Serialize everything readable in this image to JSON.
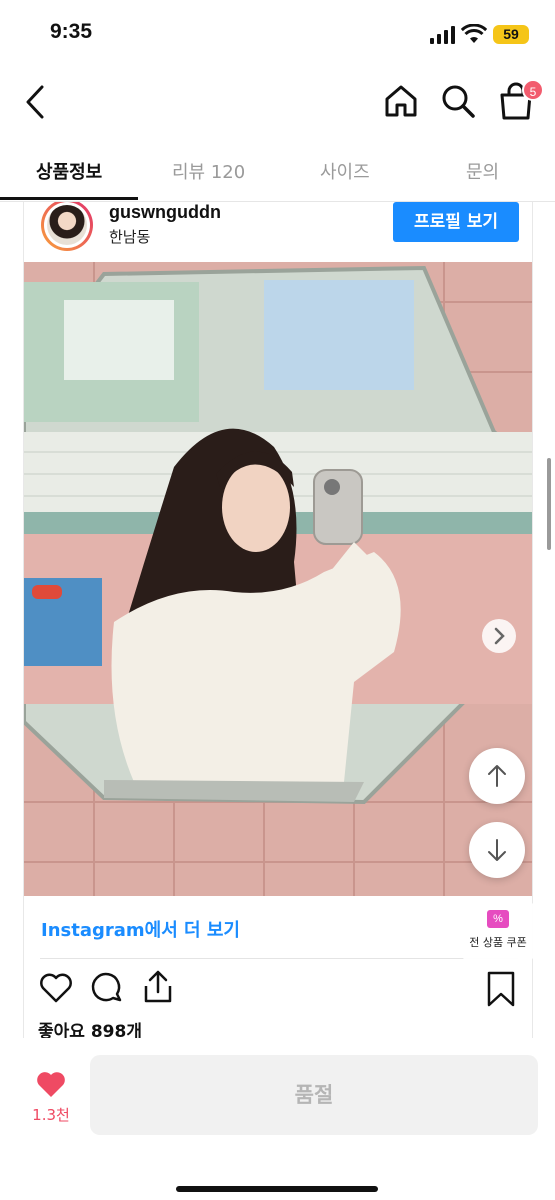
{
  "status_bar": {
    "time": "9:35",
    "battery": "59"
  },
  "nav": {
    "cart_count": "5"
  },
  "tabs": [
    {
      "label": "상품정보"
    },
    {
      "label": "리뷰 120"
    },
    {
      "label": "사이즈"
    },
    {
      "label": "문의"
    }
  ],
  "post": {
    "username": "guswnguddn",
    "location": "한남동",
    "profile_button": "프로필 보기",
    "instagram_link": "Instagram에서 더 보기",
    "likes": "좋아요 898개",
    "carousel_dots": 8,
    "carousel_active": 0
  },
  "coupon": {
    "label": "전 상품 쿠폰"
  },
  "bottom": {
    "like_count": "1.3천",
    "soldout_label": "품절"
  },
  "colors": {
    "accent_blue": "#1a8cff",
    "like_pink": "#ef4a63",
    "badge_red": "#f25c6e",
    "coupon_pink": "#e64cc0"
  }
}
